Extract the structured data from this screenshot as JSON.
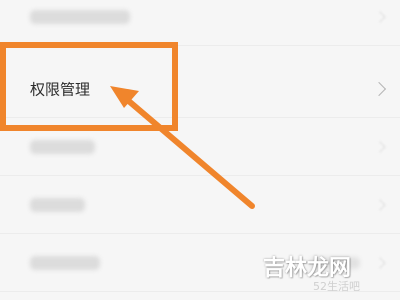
{
  "settings_list": {
    "highlighted_item": {
      "label": "权限管理",
      "icon": "chevron-right-icon"
    },
    "blurred_item_count": 4
  },
  "annotation": {
    "box_color": "#f0852c",
    "arrow_color": "#f0852c",
    "arrow_icon": "arrow-pointer-icon"
  },
  "watermark": {
    "main": "吉林龙网",
    "sub": "52生活吧"
  }
}
